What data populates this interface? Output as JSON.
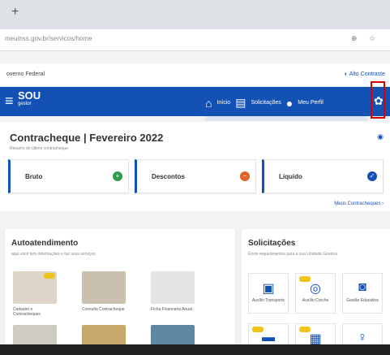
{
  "browser": {
    "new_tab_label": "+",
    "url": "meuinss.gov.br/servicos/home",
    "url_icons": "⊕ ☆"
  },
  "gov_bar": {
    "left_text": "overno Federal",
    "right_text": "◐ Alto Contraste"
  },
  "header": {
    "brand_line1": "SOU",
    "brand_line2": "gestor",
    "nav": [
      {
        "icon": "home-icon",
        "glyph": "⌂",
        "label": "Início"
      },
      {
        "icon": "document-icon",
        "glyph": "▤",
        "label": "Solicitações"
      },
      {
        "icon": "user-icon",
        "glyph": "●",
        "label": "Meu Perfil"
      }
    ],
    "settings_icon": "gear-icon"
  },
  "paycheck": {
    "title": "Contracheque | Fevereiro 2022",
    "subtitle": "Resumo do último contracheque",
    "cards": [
      {
        "label": "Bruto",
        "symbol": "+",
        "color": "#2e9d4b"
      },
      {
        "label": "Descontos",
        "symbol": "−",
        "color": "#e0632b"
      },
      {
        "label": "Líquido",
        "symbol": "✓",
        "color": "#1351b4"
      }
    ],
    "more_link": "Meus Contracheques ›"
  },
  "autoatendimento": {
    "title": "Autoatendimento",
    "subtitle": "aqui você tem informações e faz seus serviços",
    "tiles": [
      {
        "caption": "Cadastro e Contracheques"
      },
      {
        "caption": "Consulta Contracheque"
      },
      {
        "caption": "Ficha Financeira Anual"
      }
    ]
  },
  "solicitacoes": {
    "title": "Solicitações",
    "subtitle": "Envie requerimentos para a sua Unidade Gestora",
    "buttons": [
      {
        "icon": "bus-icon",
        "glyph": "▣",
        "caption": "Auxílio Transporte",
        "badge": false
      },
      {
        "icon": "search-icon",
        "glyph": "◎",
        "caption": "Auxílio Creche",
        "badge": true
      },
      {
        "icon": "money-icon",
        "glyph": "◙",
        "caption": "Gestão Educativa",
        "badge": false
      },
      {
        "icon": "card-icon",
        "glyph": "▬",
        "caption": "",
        "badge": true
      },
      {
        "icon": "building-icon",
        "glyph": "▦",
        "caption": "",
        "badge": true
      },
      {
        "icon": "person-icon",
        "glyph": "♀",
        "caption": "",
        "badge": false
      }
    ]
  }
}
